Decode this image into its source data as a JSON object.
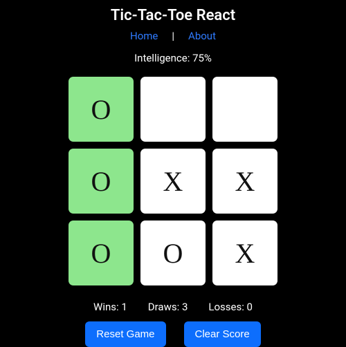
{
  "title": "Tic-Tac-Toe React",
  "nav": {
    "home": "Home",
    "about": "About",
    "sep": "|"
  },
  "intel_label": "Intelligence: 75%",
  "board": {
    "cells": [
      {
        "mark": "O",
        "win": true
      },
      {
        "mark": "",
        "win": false
      },
      {
        "mark": "",
        "win": false
      },
      {
        "mark": "O",
        "win": true
      },
      {
        "mark": "X",
        "win": false
      },
      {
        "mark": "X",
        "win": false
      },
      {
        "mark": "O",
        "win": true
      },
      {
        "mark": "O",
        "win": false
      },
      {
        "mark": "X",
        "win": false
      }
    ]
  },
  "stats": {
    "wins": "Wins: 1",
    "draws": "Draws: 3",
    "losses": "Losses: 0"
  },
  "buttons": {
    "reset": "Reset Game",
    "clear": "Clear Score"
  }
}
